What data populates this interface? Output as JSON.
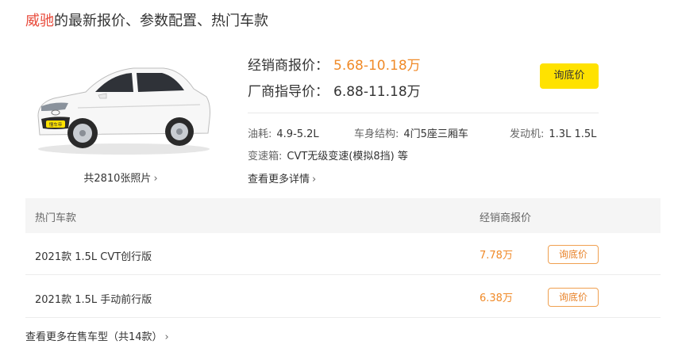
{
  "header": {
    "brand": "威驰",
    "title_rest": "的最新报价、参数配置、热门车款"
  },
  "car": {
    "photos_link": "共2810张照片",
    "badge": "懂车帝"
  },
  "prices": {
    "dealer_label": "经销商报价：",
    "dealer_value": "5.68-10.18万",
    "msrp_label": "厂商指导价：",
    "msrp_value": "6.88-11.18万",
    "inquire_button": "询底价"
  },
  "specs": {
    "fuel_label": "油耗:",
    "fuel_value": "4.9-5.2L",
    "body_label": "车身结构:",
    "body_value": "4门5座三厢车",
    "engine_label": "发动机:",
    "engine_value": "1.3L 1.5L",
    "gearbox_label": "变速箱:",
    "gearbox_value": "CVT无级变速(模拟8挡) 等",
    "more_details": "查看更多详情"
  },
  "table": {
    "col_model": "热门车款",
    "col_price": "经销商报价",
    "rows": [
      {
        "name": "2021款 1.5L CVT创行版",
        "price": "7.78万",
        "button": "询底价"
      },
      {
        "name": "2021款 1.5L 手动前行版",
        "price": "6.38万",
        "button": "询底价"
      }
    ]
  },
  "footer": {
    "more_models": "查看更多在售车型（共14款）"
  },
  "colors": {
    "accent_orange": "#f08a28",
    "brand_red": "#e84c3d",
    "button_yellow": "#ffe200"
  }
}
